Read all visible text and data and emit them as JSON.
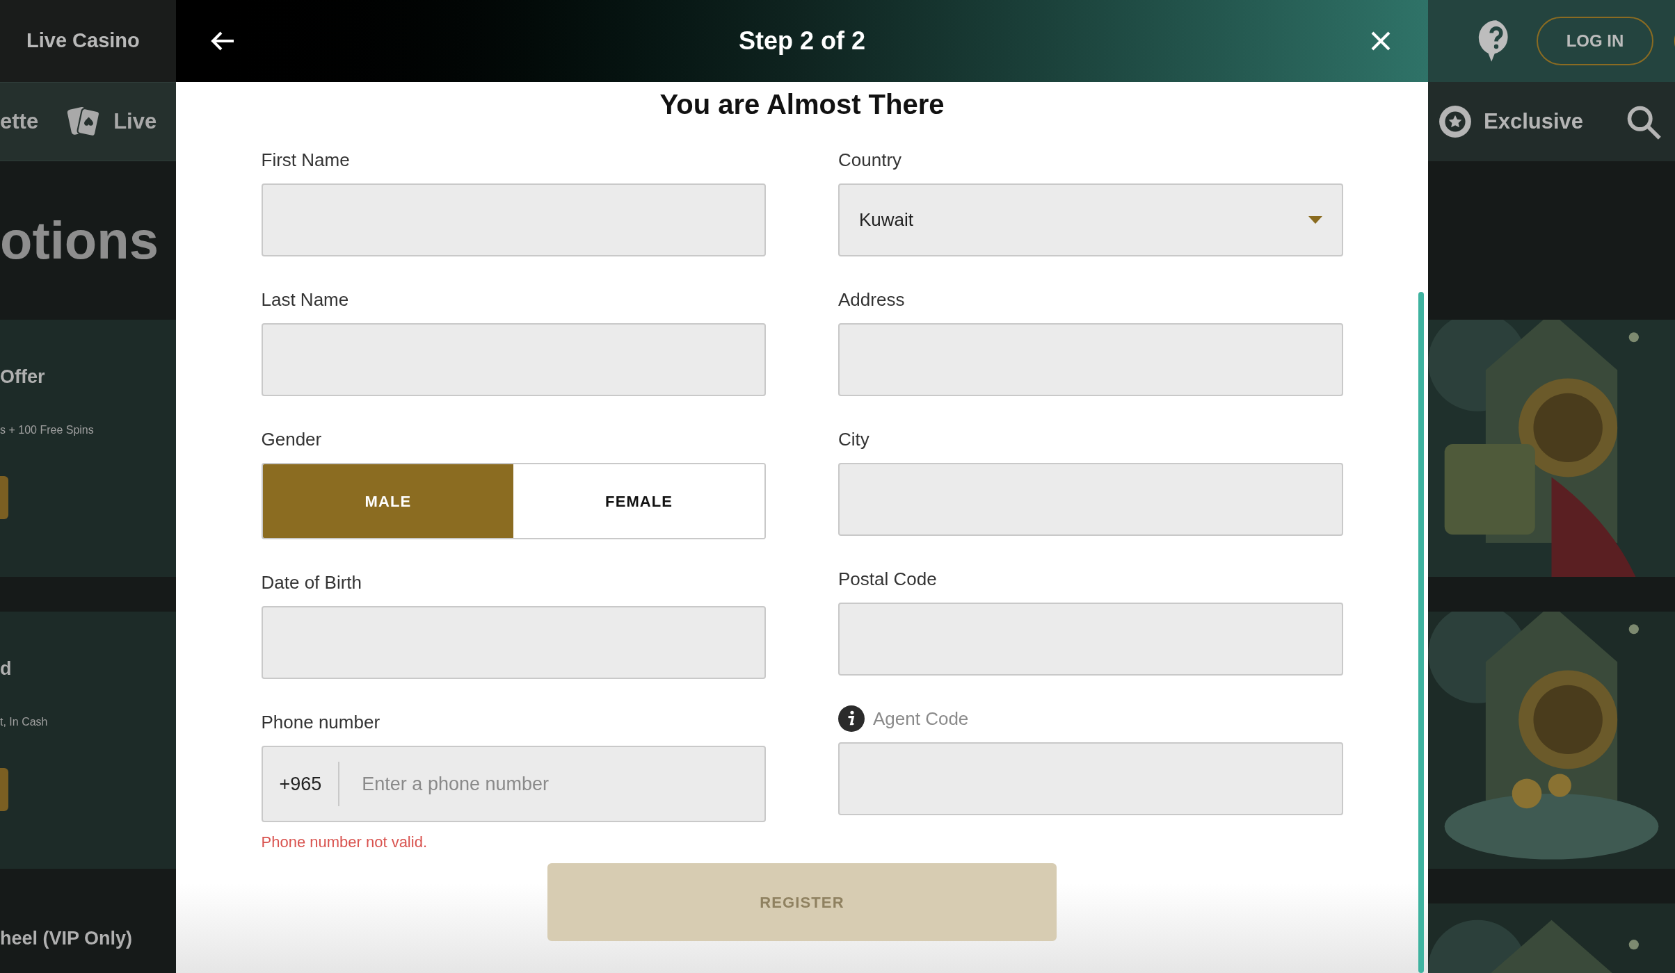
{
  "background_left": {
    "brand": "Live Casino",
    "nav": [
      {
        "label": "ette",
        "icon": false
      },
      {
        "label": "Live",
        "icon": true
      }
    ],
    "heading": "otions",
    "promos": [
      {
        "title": "Offer",
        "subtitle": "s + 100 Free Spins"
      },
      {
        "title": "d",
        "subtitle": "t, In Cash"
      }
    ],
    "footer_title": "heel (VIP Only)"
  },
  "background_right": {
    "login_button": "LOG IN",
    "nav_item": "Exclusive"
  },
  "dialog": {
    "title": "Step 2 of 2",
    "heading": "You are Almost There",
    "left_column": [
      {
        "kind": "text",
        "label": "First Name"
      },
      {
        "kind": "text",
        "label": "Last Name"
      },
      {
        "kind": "gender",
        "label": "Gender",
        "options": [
          {
            "label": "MALE",
            "selected": true
          },
          {
            "label": "FEMALE",
            "selected": false
          }
        ]
      },
      {
        "kind": "text",
        "label": "Date of Birth"
      },
      {
        "kind": "phone",
        "label": "Phone number",
        "prefix": "+965",
        "placeholder": "Enter a phone number",
        "error": "Phone number not valid."
      }
    ],
    "right_column": [
      {
        "kind": "select",
        "label": "Country",
        "value": "Kuwait"
      },
      {
        "kind": "text",
        "label": "Address"
      },
      {
        "kind": "text",
        "label": "City"
      },
      {
        "kind": "text",
        "label": "Postal Code"
      },
      {
        "kind": "text",
        "label": "Agent Code",
        "info": true
      }
    ],
    "register": {
      "label": "REGISTER",
      "disabled": true
    }
  }
}
